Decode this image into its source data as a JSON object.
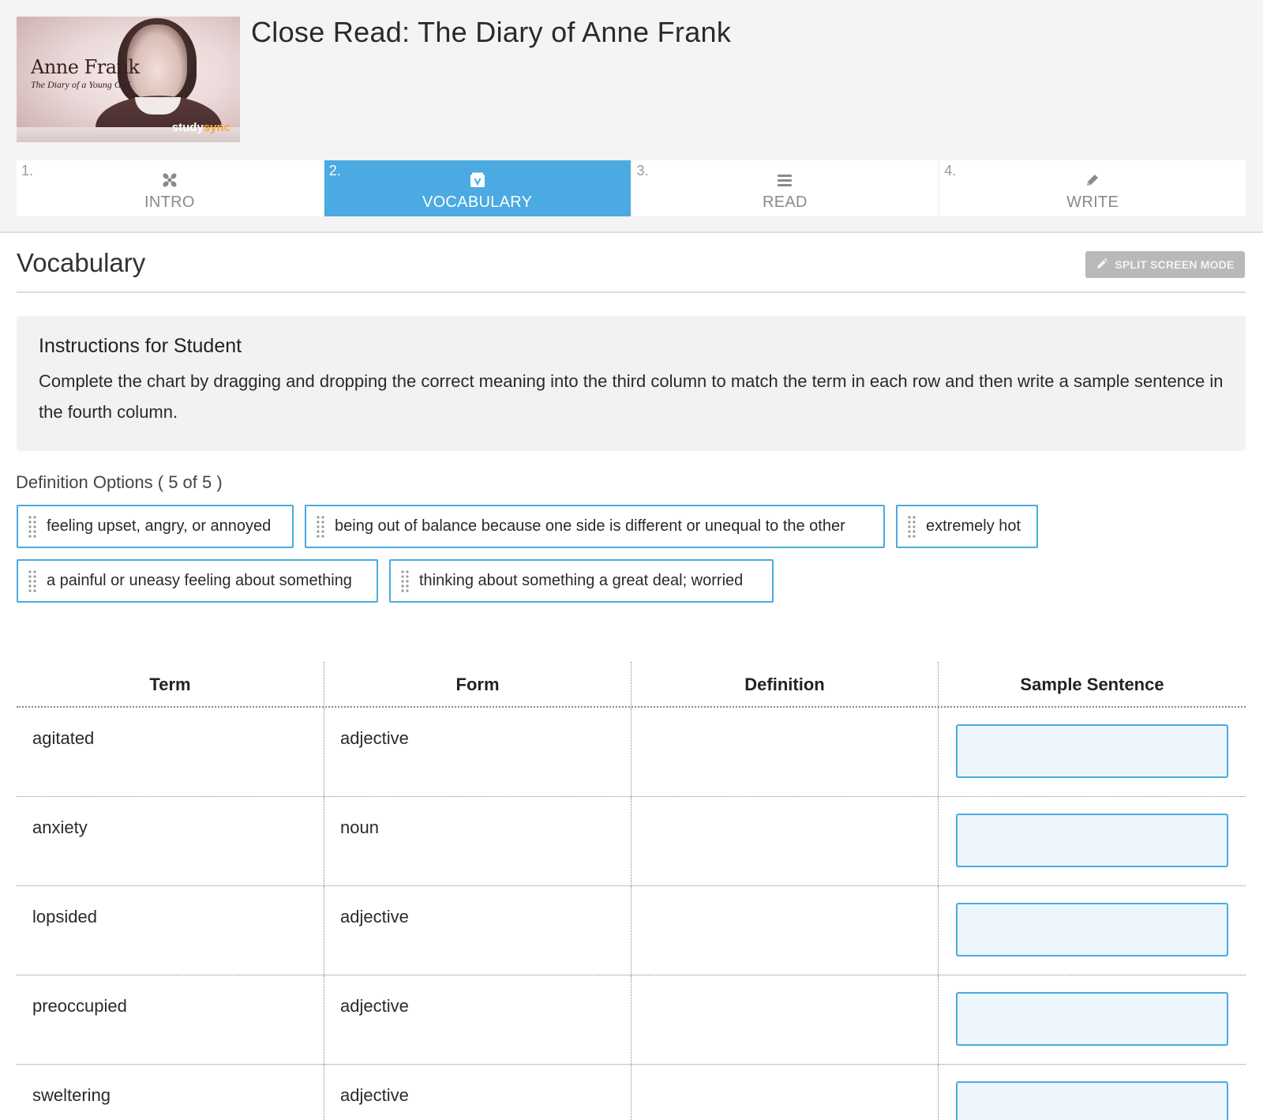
{
  "header": {
    "title": "Close Read: The Diary of Anne Frank",
    "thumbnail": {
      "title": "Anne Frank",
      "subtitle": "The Diary of a Young Girl",
      "brand_a": "study",
      "brand_b": "sync"
    }
  },
  "tabs": [
    {
      "num": "1.",
      "label": "INTRO",
      "icon": "intro-icon",
      "active": false
    },
    {
      "num": "2.",
      "label": "VOCABULARY",
      "icon": "vocabulary-icon",
      "active": true
    },
    {
      "num": "3.",
      "label": "READ",
      "icon": "read-icon",
      "active": false
    },
    {
      "num": "4.",
      "label": "WRITE",
      "icon": "pencil-icon",
      "active": false
    }
  ],
  "section": {
    "title": "Vocabulary",
    "split_label": "SPLIT SCREEN MODE"
  },
  "instructions": {
    "heading": "Instructions for Student",
    "text": "Complete the chart by dragging and dropping the correct meaning into the third column to match the term in each row and then write a sample sentence in the fourth column."
  },
  "options": {
    "heading": "Definition Options ( 5 of 5 )",
    "items": [
      "feeling upset, angry, or annoyed",
      "being out of balance because one side is different or unequal to the other",
      "extremely hot",
      "a painful or uneasy feeling about something",
      "thinking about something a great deal; worried"
    ]
  },
  "table": {
    "headers": [
      "Term",
      "Form",
      "Definition",
      "Sample Sentence"
    ],
    "rows": [
      {
        "term": "agitated",
        "form": "adjective",
        "definition": "",
        "sentence": ""
      },
      {
        "term": "anxiety",
        "form": "noun",
        "definition": "",
        "sentence": ""
      },
      {
        "term": "lopsided",
        "form": "adjective",
        "definition": "",
        "sentence": ""
      },
      {
        "term": "preoccupied",
        "form": "adjective",
        "definition": "",
        "sentence": ""
      },
      {
        "term": "sweltering",
        "form": "adjective",
        "definition": "",
        "sentence": ""
      }
    ]
  },
  "colors": {
    "accent": "#4aaae1",
    "header_bg": "#f4f4f4",
    "button_gray": "#b9b9b9",
    "input_bg": "#eef6fd"
  }
}
